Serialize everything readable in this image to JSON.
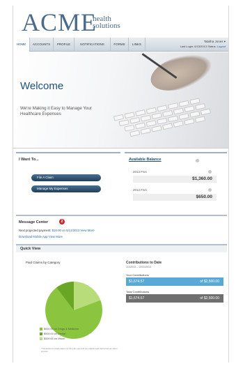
{
  "brand": {
    "name": "ACME",
    "tagline_line1": "health",
    "tagline_line2": "solutions"
  },
  "nav": {
    "tabs": [
      {
        "label": "HOME"
      },
      {
        "label": "ACCOUNTS"
      },
      {
        "label": "PROFILE"
      },
      {
        "label": "NOTIFICATIONS"
      },
      {
        "label": "FORMS"
      },
      {
        "label": "LINKS"
      }
    ],
    "active_tab": "HOME"
  },
  "user": {
    "name": "Tabitha Jones ▾",
    "last_login": "Last Login: 6/15/2013",
    "status": "Status:",
    "logout": "Logout"
  },
  "hero": {
    "title": "Welcome",
    "text": "We're Making it Easy to Manage Your Healthcare Expenses"
  },
  "iwant": {
    "title": "I Want To...",
    "actions": [
      {
        "label": "File A Claim"
      },
      {
        "label": "Manage My Expenses"
      }
    ]
  },
  "balance": {
    "title": "Available Balance",
    "accounts": [
      {
        "label": "2013 FSA",
        "value": "$1,360.00"
      },
      {
        "label": "2012 FSA",
        "value": "$650.00"
      }
    ]
  },
  "messages": {
    "title": "Message Center",
    "count": "2",
    "line1_prefix": "Next projected payment:",
    "line1_value": "$10.00 on 6/12/2013",
    "line1_link": "View More",
    "line2_text": "Download Mobile App",
    "line2_link": "View More"
  },
  "quick_view": {
    "title": "Quick View",
    "paid_claims_title": "Paid Claims by Category",
    "legend": [
      {
        "label": "$000.00 on Drugs & Medicine",
        "color": "#8bc53f"
      },
      {
        "label": "$000.00 on Dental",
        "color": "#6aa626"
      },
      {
        "label": "$000.00 on Vision",
        "color": "#b8dc7a"
      }
    ],
    "footnote": "*Transactions include claims for this plan year and any eligible paid claims that are still in process",
    "contrib_title": "Contributions to Date",
    "contrib_range": "1/1/2013 – 12/31/2013",
    "your_label": "Your Contributions",
    "your_amount": "$1,674.57",
    "your_of": "of $2,500.00",
    "total_label": "Total Contributions",
    "total_amount": "$1,674.57",
    "total_of": "of $2,500.00"
  },
  "colors": {
    "brand_blue": "#4a6b89",
    "accent_blue": "#58a9d6",
    "pie_green": "#8bc53f"
  }
}
